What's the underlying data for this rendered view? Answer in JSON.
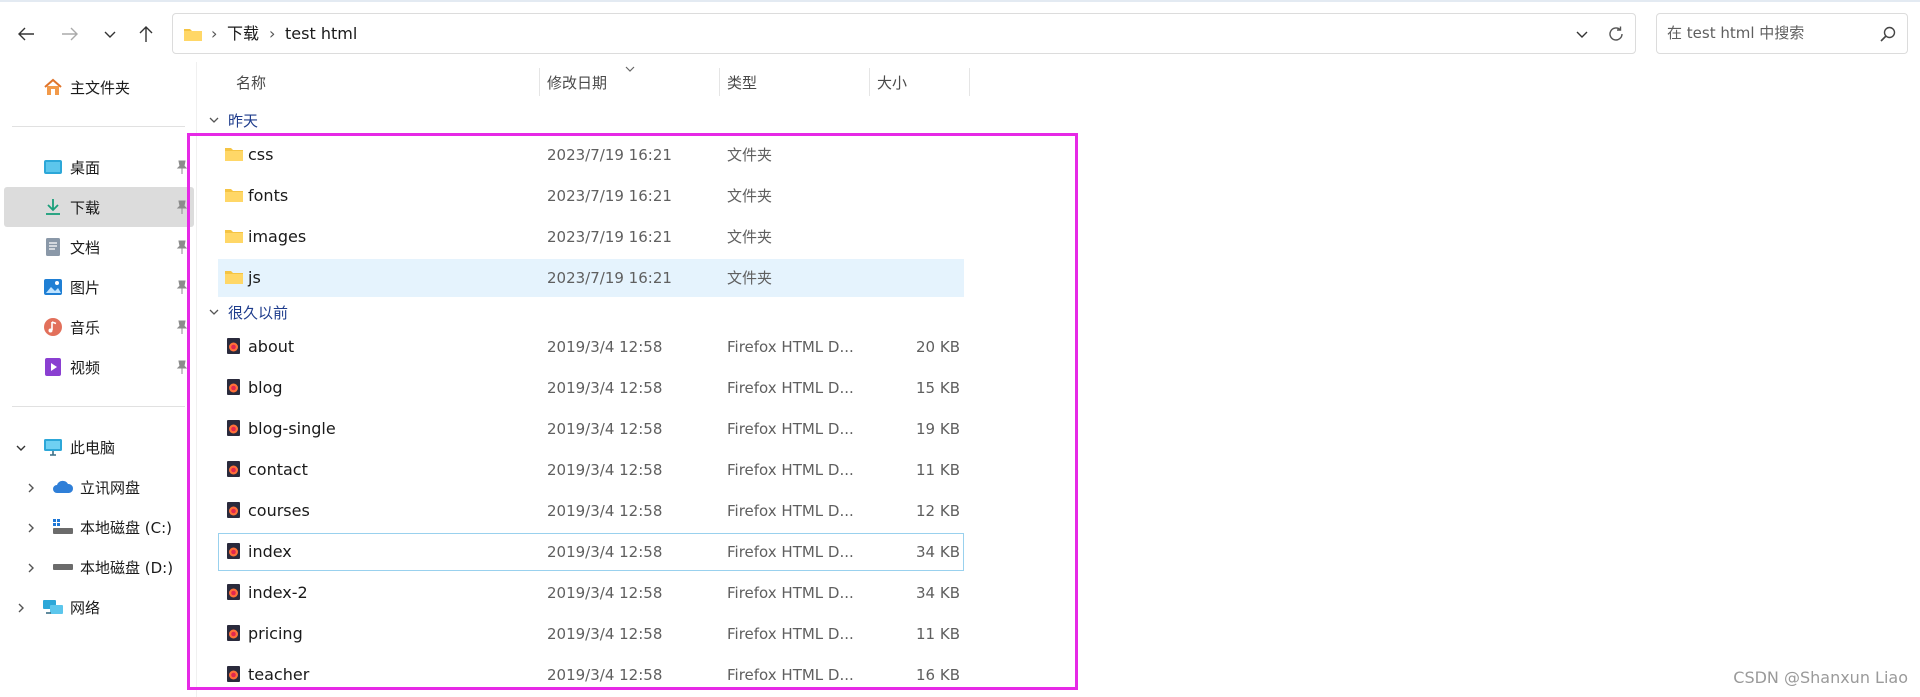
{
  "address_bar": {
    "breadcrumb": [
      "下载",
      "test html"
    ],
    "separator": "›"
  },
  "search": {
    "placeholder": "在 test html 中搜索"
  },
  "sidebar": {
    "home": {
      "label": "主文件夹",
      "icon": "home-icon"
    },
    "quick_access": [
      {
        "label": "桌面",
        "icon": "desktop-icon",
        "pinned": true
      },
      {
        "label": "下载",
        "icon": "download-icon",
        "pinned": true,
        "selected": true
      },
      {
        "label": "文档",
        "icon": "document-icon",
        "pinned": true
      },
      {
        "label": "图片",
        "icon": "pictures-icon",
        "pinned": true
      },
      {
        "label": "音乐",
        "icon": "music-icon",
        "pinned": true
      },
      {
        "label": "视频",
        "icon": "video-icon",
        "pinned": true
      }
    ],
    "this_pc": {
      "label": "此电脑",
      "icon": "computer-icon",
      "children": [
        {
          "label": "立讯网盘",
          "icon": "cloud-icon"
        },
        {
          "label": "本地磁盘 (C:)",
          "icon": "drive-c-icon"
        },
        {
          "label": "本地磁盘 (D:)",
          "icon": "drive-icon"
        }
      ]
    },
    "network": {
      "label": "网络",
      "icon": "network-icon"
    }
  },
  "columns": {
    "name": "名称",
    "modified": "修改日期",
    "type": "类型",
    "size": "大小"
  },
  "groups": [
    {
      "label": "昨天",
      "files": [
        {
          "name": "css",
          "date": "2023/7/19 16:21",
          "type": "文件夹",
          "size": "",
          "icon": "folder-icon"
        },
        {
          "name": "fonts",
          "date": "2023/7/19 16:21",
          "type": "文件夹",
          "size": "",
          "icon": "folder-icon"
        },
        {
          "name": "images",
          "date": "2023/7/19 16:21",
          "type": "文件夹",
          "size": "",
          "icon": "folder-icon"
        },
        {
          "name": "js",
          "date": "2023/7/19 16:21",
          "type": "文件夹",
          "size": "",
          "icon": "folder-icon",
          "hovered": true
        }
      ]
    },
    {
      "label": "很久以前",
      "files": [
        {
          "name": "about",
          "date": "2019/3/4 12:58",
          "type": "Firefox HTML D...",
          "size": "20 KB",
          "icon": "firefox-html-icon"
        },
        {
          "name": "blog",
          "date": "2019/3/4 12:58",
          "type": "Firefox HTML D...",
          "size": "15 KB",
          "icon": "firefox-html-icon"
        },
        {
          "name": "blog-single",
          "date": "2019/3/4 12:58",
          "type": "Firefox HTML D...",
          "size": "19 KB",
          "icon": "firefox-html-icon"
        },
        {
          "name": "contact",
          "date": "2019/3/4 12:58",
          "type": "Firefox HTML D...",
          "size": "11 KB",
          "icon": "firefox-html-icon"
        },
        {
          "name": "courses",
          "date": "2019/3/4 12:58",
          "type": "Firefox HTML D...",
          "size": "12 KB",
          "icon": "firefox-html-icon"
        },
        {
          "name": "index",
          "date": "2019/3/4 12:58",
          "type": "Firefox HTML D...",
          "size": "34 KB",
          "icon": "firefox-html-icon",
          "focused": true
        },
        {
          "name": "index-2",
          "date": "2019/3/4 12:58",
          "type": "Firefox HTML D...",
          "size": "34 KB",
          "icon": "firefox-html-icon"
        },
        {
          "name": "pricing",
          "date": "2019/3/4 12:58",
          "type": "Firefox HTML D...",
          "size": "11 KB",
          "icon": "firefox-html-icon"
        },
        {
          "name": "teacher",
          "date": "2019/3/4 12:58",
          "type": "Firefox HTML D...",
          "size": "16 KB",
          "icon": "firefox-html-icon"
        }
      ]
    }
  ],
  "colors": {
    "highlight_box": "#e629e6",
    "group_label": "#1e3c8c",
    "hover_row": "#e5f3fd",
    "focus_border": "#99d1ee",
    "selected_sidebar": "#dcdcdc"
  },
  "watermark": "CSDN @Shanxun Liao"
}
